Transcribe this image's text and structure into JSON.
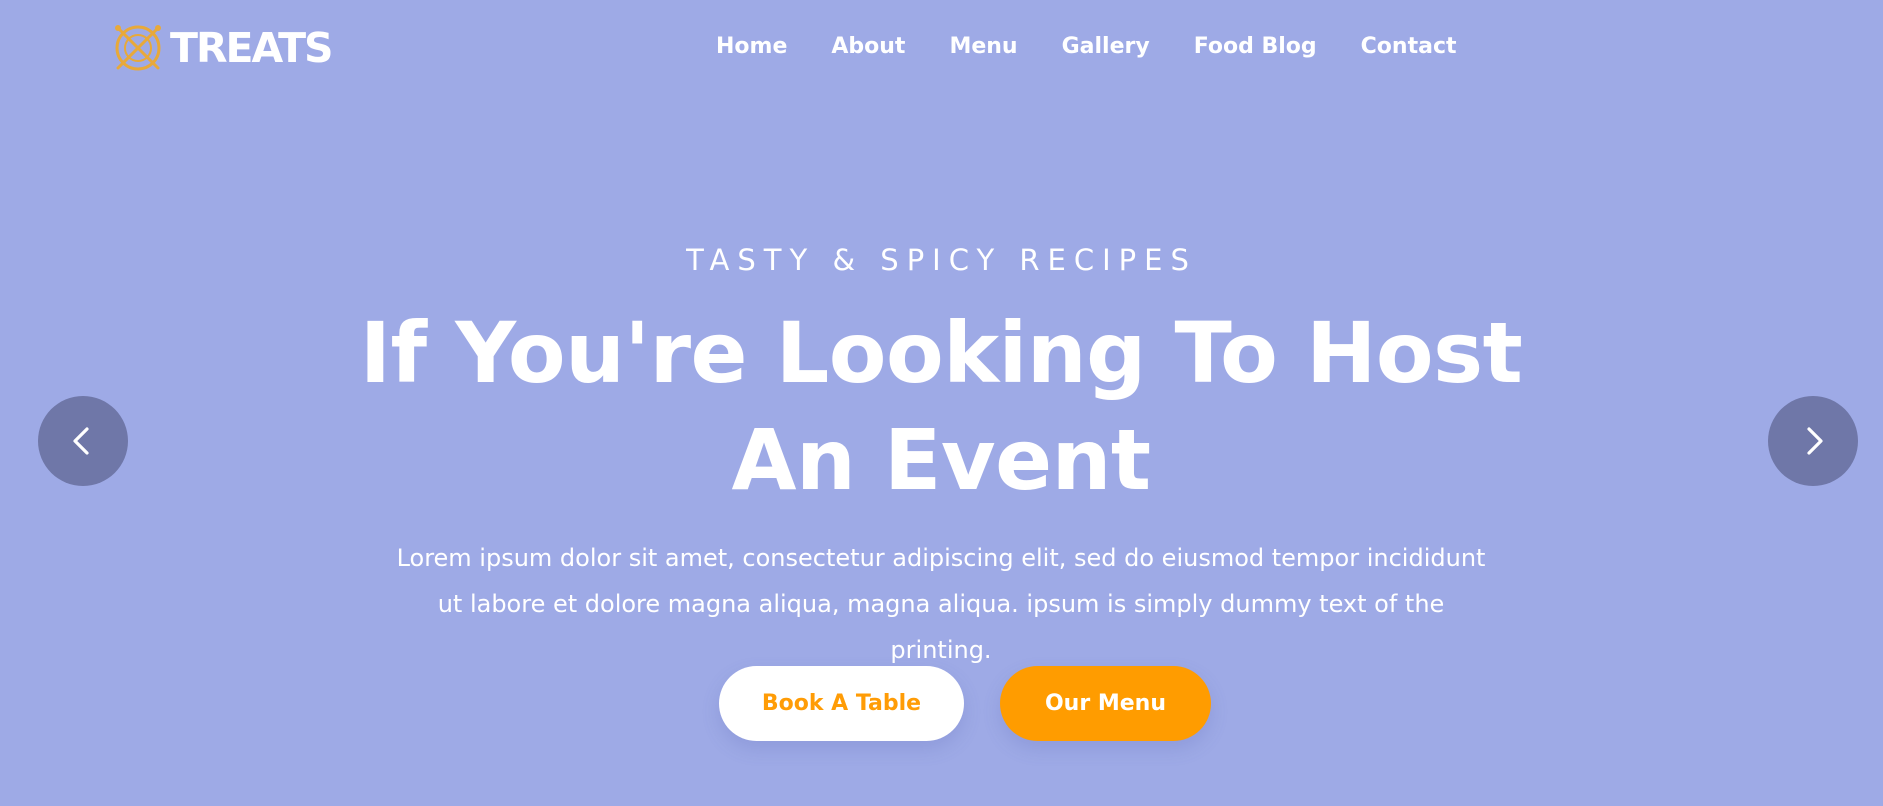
{
  "header": {
    "logo_text": "TREATS",
    "logo_icon": "crossed-utensils-plate-icon",
    "nav": [
      {
        "label": "Home"
      },
      {
        "label": "About"
      },
      {
        "label": "Menu"
      },
      {
        "label": "Gallery"
      },
      {
        "label": "Food Blog"
      },
      {
        "label": "Contact"
      }
    ]
  },
  "hero": {
    "eyebrow": "TASTY & SPICY RECIPES",
    "headline": "If You're Looking To Host An Event",
    "description": "Lorem ipsum dolor sit amet, consectetur adipiscing elit, sed do eiusmod tempor incididunt ut labore et dolore magna aliqua, magna aliqua. ipsum is simply dummy text of the printing.",
    "primary_button": "Book A Table",
    "secondary_button": "Our Menu"
  },
  "slider": {
    "prev_icon": "chevron-left-icon",
    "next_icon": "chevron-right-icon"
  },
  "colors": {
    "background": "#9eaae6",
    "accent": "#ff9c00",
    "arrow_bg": "#6f77a8",
    "logo_gold": "#e8a93a"
  }
}
